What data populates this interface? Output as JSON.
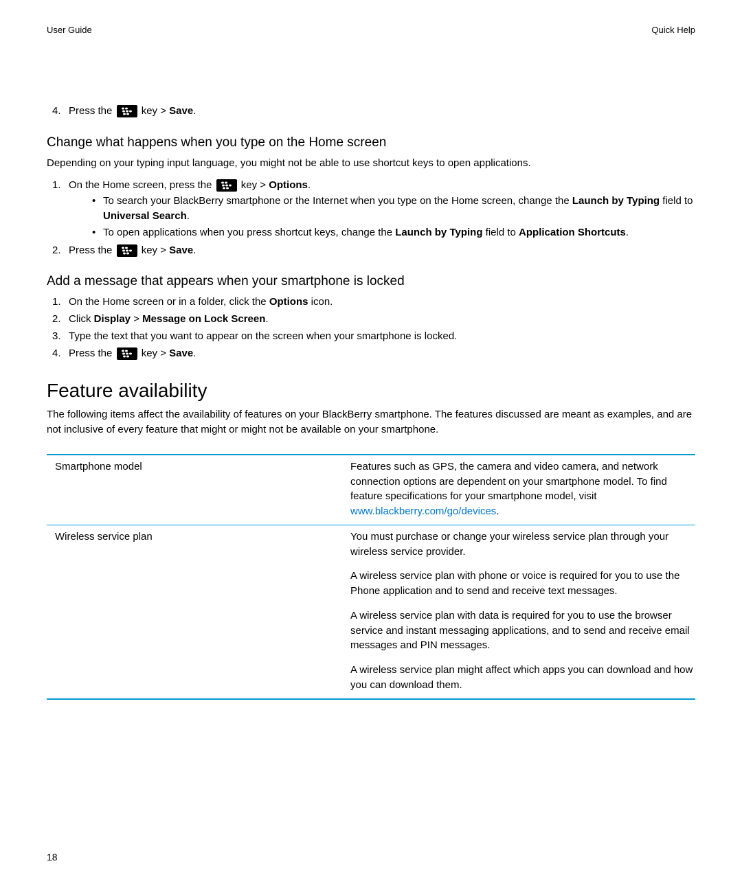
{
  "header": {
    "left": "User Guide",
    "right": "Quick Help"
  },
  "page_number": "18",
  "step4": {
    "num": "4.",
    "pre": "Press the ",
    "mid": " key > ",
    "bold": "Save",
    "post": "."
  },
  "sectionA": {
    "title": "Change what happens when you type on the Home screen",
    "intro": "Depending on your typing input language, you might not be able to use shortcut keys to open applications.",
    "step1": {
      "num": "1.",
      "pre": "On the Home screen, press the ",
      "mid": " key > ",
      "bold": "Options",
      "post": "."
    },
    "bullet1": {
      "t1": "To search your BlackBerry smartphone or the Internet when you type on the Home screen, change the ",
      "b1": "Launch by Typing",
      "t2": " field to ",
      "b2": "Universal Search",
      "t3": "."
    },
    "bullet2": {
      "t1": "To open applications when you press shortcut keys, change the ",
      "b1": "Launch by Typing",
      "t2": " field to ",
      "b2": "Application Shortcuts",
      "t3": "."
    },
    "step2": {
      "num": "2.",
      "pre": "Press the ",
      "mid": " key > ",
      "bold": "Save",
      "post": "."
    }
  },
  "sectionB": {
    "title": "Add a message that appears when your smartphone is locked",
    "s1": {
      "num": "1.",
      "t1": "On the Home screen or in a folder, click the ",
      "b1": "Options",
      "t2": " icon."
    },
    "s2": {
      "num": "2.",
      "t1": "Click ",
      "b1": "Display",
      "t2": " > ",
      "b2": "Message on Lock Screen",
      "t3": "."
    },
    "s3": {
      "num": "3.",
      "t1": "Type the text that you want to appear on the screen when your smartphone is locked."
    },
    "s4": {
      "num": "4.",
      "pre": "Press the ",
      "mid": " key > ",
      "bold": "Save",
      "post": "."
    }
  },
  "feature": {
    "title": "Feature availability",
    "intro": "The following items affect the availability of features on your BlackBerry smartphone. The features discussed are meant as examples, and are not inclusive of every feature that might or might not be available on your smartphone.",
    "link": {
      "text": "www.blackberry.com/go/devices"
    },
    "rows": [
      {
        "term": "Smartphone model",
        "p1a": "Features such as GPS, the camera and video camera, and network connection options are dependent on your smartphone model. To find feature specifications for your smartphone model, visit ",
        "p1c": "."
      },
      {
        "term": "Wireless service plan",
        "p1": "You must purchase or change your wireless service plan through your wireless service provider.",
        "p2": "A wireless service plan with phone or voice is required for you to use the Phone application and to send and receive text messages.",
        "p3": "A wireless service plan with data is required for you to use the browser service and instant messaging applications, and to send and receive email messages and PIN messages.",
        "p4": "A wireless service plan might affect which apps you can download and how you can download them."
      }
    ]
  }
}
